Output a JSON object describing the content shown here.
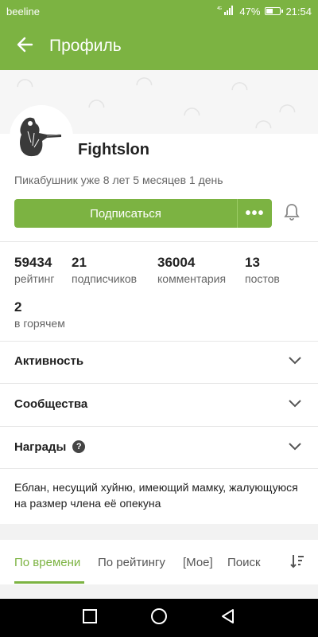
{
  "status_bar": {
    "carrier": "beeline",
    "network": "4G",
    "battery_percent": "47%",
    "battery_level": 0.47,
    "time": "21:54"
  },
  "app_bar": {
    "title": "Профиль",
    "back_icon": "arrow-left-icon"
  },
  "profile": {
    "nickname": "Fightslon",
    "since": "Пикабушник уже 8 лет 5 месяцев 1 день",
    "subscribe_label": "Подписаться",
    "more_label": "•••",
    "bell_icon": "bell-icon"
  },
  "stats": [
    {
      "value": "59434",
      "label": "рейтинг"
    },
    {
      "value": "21",
      "label": "подписчиков"
    },
    {
      "value": "36004",
      "label": "комментария"
    },
    {
      "value": "13",
      "label": "постов"
    },
    {
      "value": "2",
      "label": "в горячем"
    }
  ],
  "sections": [
    {
      "title": "Активность"
    },
    {
      "title": "Сообщества"
    },
    {
      "title": "Награды",
      "help": "?"
    }
  ],
  "bio": "Еблан, несущий хуйню, имеющий мамку, жалующуюся на размер члена её опекуна",
  "tabs": [
    {
      "label": "По времени",
      "active": true
    },
    {
      "label": "По рейтингу"
    },
    {
      "label": "[Мое]"
    },
    {
      "label": "Поиск"
    }
  ],
  "sort_icon": "sort-icon",
  "colors": {
    "accent": "#7cb342",
    "nav_bar": "#000000"
  }
}
